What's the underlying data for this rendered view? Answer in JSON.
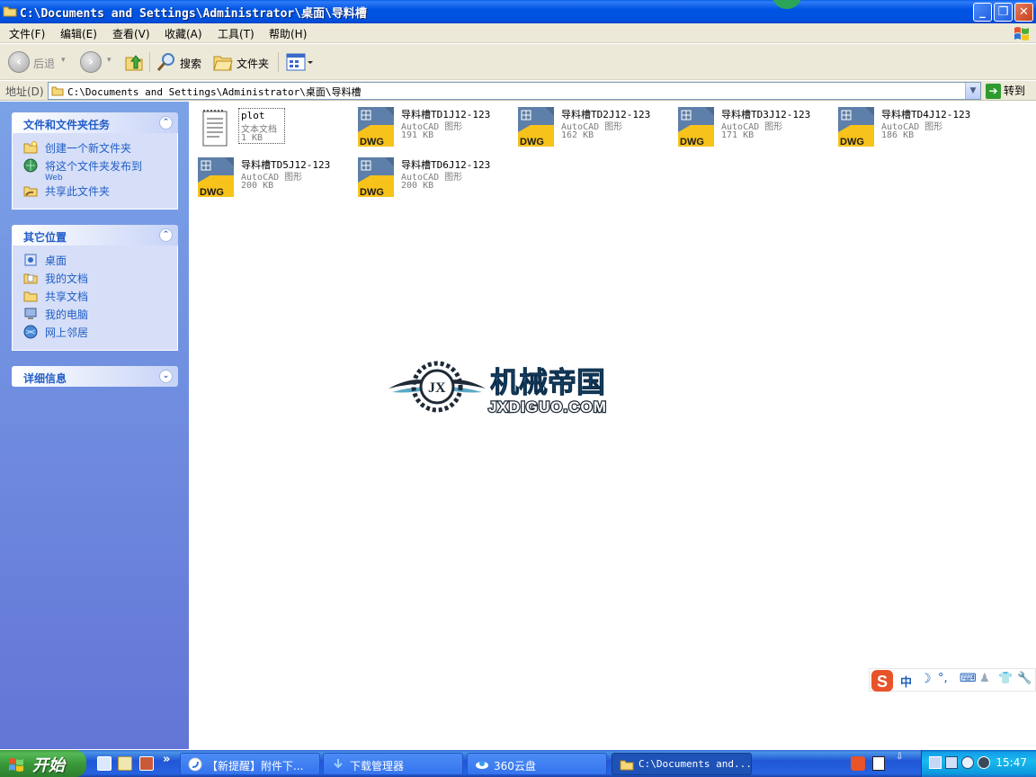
{
  "window": {
    "title": "C:\\Documents and Settings\\Administrator\\桌面\\导料槽",
    "controls": {
      "minimize": "_",
      "maximize": "❐",
      "close": "✕"
    }
  },
  "menu": [
    "文件(F)",
    "编辑(E)",
    "查看(V)",
    "收藏(A)",
    "工具(T)",
    "帮助(H)"
  ],
  "toolbar": {
    "back": "后退",
    "search": "搜索",
    "folders": "文件夹"
  },
  "address": {
    "label": "地址(D)",
    "value": "C:\\Documents and Settings\\Administrator\\桌面\\导料槽",
    "go": "转到"
  },
  "left_panel": {
    "tasks": {
      "title": "文件和文件夹任务",
      "items": [
        {
          "label": "创建一个新文件夹",
          "icon": "new-folder-icon"
        },
        {
          "label": "将这个文件夹发布到",
          "sub": "Web",
          "icon": "publish-web-icon"
        },
        {
          "label": "共享此文件夹",
          "icon": "share-folder-icon"
        }
      ]
    },
    "places": {
      "title": "其它位置",
      "items": [
        {
          "label": "桌面",
          "icon": "desktop-icon"
        },
        {
          "label": "我的文档",
          "icon": "my-documents-icon"
        },
        {
          "label": "共享文档",
          "icon": "shared-documents-icon"
        },
        {
          "label": "我的电脑",
          "icon": "my-computer-icon"
        },
        {
          "label": "网上邻居",
          "icon": "network-places-icon"
        }
      ]
    },
    "details": {
      "title": "详细信息"
    }
  },
  "files": [
    {
      "name": "plot",
      "type": "文本文档",
      "size": "1 KB",
      "kind": "txt"
    },
    {
      "name": "导料槽TD1J12-123",
      "type": "AutoCAD 图形",
      "size": "191 KB",
      "kind": "dwg"
    },
    {
      "name": "导料槽TD2J12-123",
      "type": "AutoCAD 图形",
      "size": "162 KB",
      "kind": "dwg"
    },
    {
      "name": "导料槽TD3J12-123",
      "type": "AutoCAD 图形",
      "size": "171 KB",
      "kind": "dwg"
    },
    {
      "name": "导料槽TD4J12-123",
      "type": "AutoCAD 图形",
      "size": "186 KB",
      "kind": "dwg"
    },
    {
      "name": "导料槽TD5J12-123",
      "type": "AutoCAD 图形",
      "size": "200 KB",
      "kind": "dwg"
    },
    {
      "name": "导料槽TD6J12-123",
      "type": "AutoCAD 图形",
      "size": "200 KB",
      "kind": "dwg"
    }
  ],
  "dwg_badge": "DWG",
  "watermark": {
    "cn": "机械帝国",
    "en": "JXDIGUO.COM",
    "emblem": "JX"
  },
  "ime": {
    "mode": "中",
    "logo": "S"
  },
  "taskbar": {
    "start": "开始",
    "more": "»",
    "tasks": [
      {
        "label": "【新提醒】附件下...",
        "active": false
      },
      {
        "label": "下载管理器",
        "active": false
      },
      {
        "label": "360云盘",
        "active": false
      },
      {
        "label": "C:\\Documents and...",
        "active": true
      }
    ],
    "clock": "15:47"
  },
  "colors": {
    "titlebar": "#0054e3",
    "left_pane_top": "#7ba2e7",
    "left_pane_bottom": "#6375d6",
    "link": "#215dc6",
    "watermark_cn": "#1f5a8a",
    "watermark_en": "#1e2a36",
    "dwg_yellow": "#f7c21a"
  }
}
